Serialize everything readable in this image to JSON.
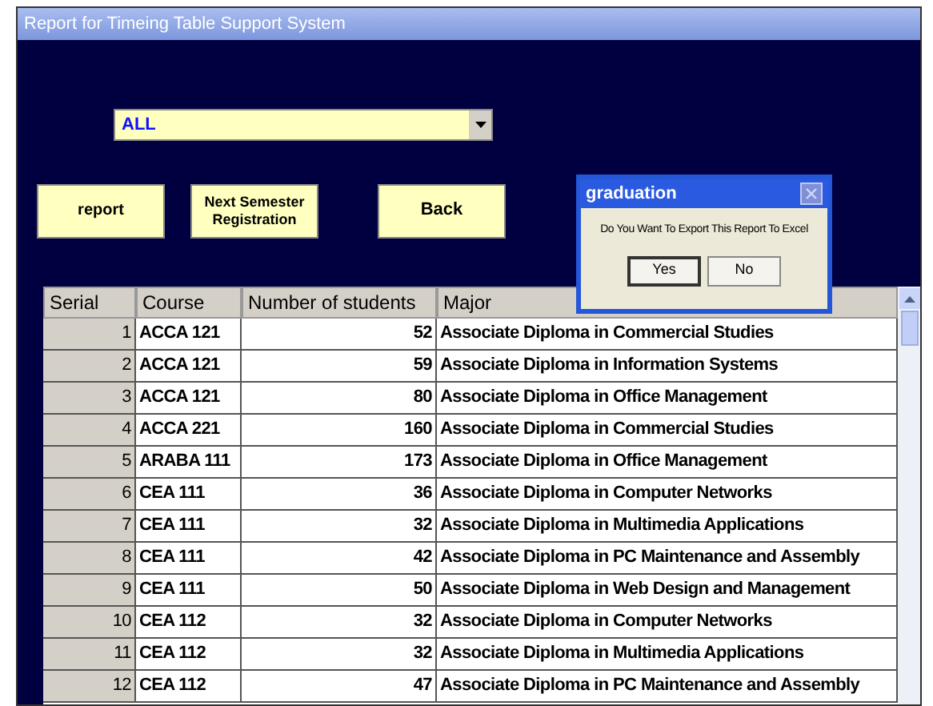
{
  "window": {
    "title": "Report for Timeing Table Support System"
  },
  "filter": {
    "value": "ALL"
  },
  "buttons": [
    "report",
    "Next Semester Registration",
    "Back"
  ],
  "table": {
    "columns": [
      "Serial",
      "Course",
      "Number of students",
      "Major"
    ],
    "rows": [
      [
        "1",
        "ACCA 121",
        "52",
        "Associate Diploma in Commercial Studies"
      ],
      [
        "2",
        "ACCA 121",
        "59",
        "Associate Diploma in Information Systems"
      ],
      [
        "3",
        "ACCA 121",
        "80",
        "Associate Diploma in Office Management"
      ],
      [
        "4",
        "ACCA 221",
        "160",
        "Associate Diploma in Commercial Studies"
      ],
      [
        "5",
        "ARABA 111",
        "173",
        "Associate Diploma in Office Management"
      ],
      [
        "6",
        "CEA 111",
        "36",
        "Associate Diploma in Computer Networks"
      ],
      [
        "7",
        "CEA 111",
        "32",
        "Associate Diploma in Multimedia Applications"
      ],
      [
        "8",
        "CEA 111",
        "42",
        "Associate Diploma in PC Maintenance and Assembly"
      ],
      [
        "9",
        "CEA 111",
        "50",
        "Associate Diploma in Web Design and Management"
      ],
      [
        "10",
        "CEA 112",
        "32",
        "Associate Diploma in Computer Networks"
      ],
      [
        "11",
        "CEA 112",
        "32",
        "Associate Diploma in Multimedia Applications"
      ],
      [
        "12",
        "CEA 112",
        "47",
        "Associate Diploma in PC Maintenance and Assembly"
      ]
    ]
  },
  "dialog": {
    "title": "graduation",
    "message": "Do You Want To Export This Report To Excel",
    "buttons": [
      "Yes",
      "No"
    ]
  }
}
